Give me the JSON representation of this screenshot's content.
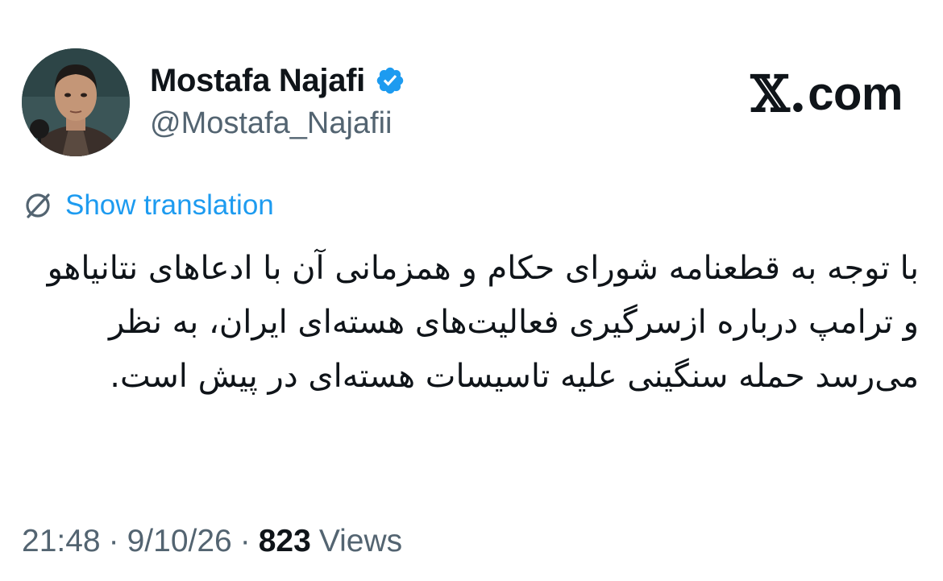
{
  "author": {
    "display_name": "Mostafa Najafi",
    "handle": "@Mostafa_Najafii",
    "verified": true,
    "verified_color": "#1d9bf0"
  },
  "brand": {
    "logo_text": "com",
    "logo_prefix": "𝕏."
  },
  "translation": {
    "link_text": "Show translation",
    "icon": "translate-globe-icon"
  },
  "tweet": {
    "text": "با توجه به قطعنامه شورای حکام و همزمانی آن با ادعاهای نتانیاهو و ترامپ درباره ازسرگیری فعالیت‌های هسته‌ای ایران، به نظر می‌رسد حمله سنگینی علیه تاسیسات هسته‌ای در پیش است."
  },
  "meta": {
    "time": "21:48",
    "separator": "·",
    "date": "9/10/26",
    "views_count": "823",
    "views_label": "Views"
  },
  "colors": {
    "text_primary": "#0f1419",
    "text_secondary": "#536471",
    "link": "#1d9bf0"
  }
}
